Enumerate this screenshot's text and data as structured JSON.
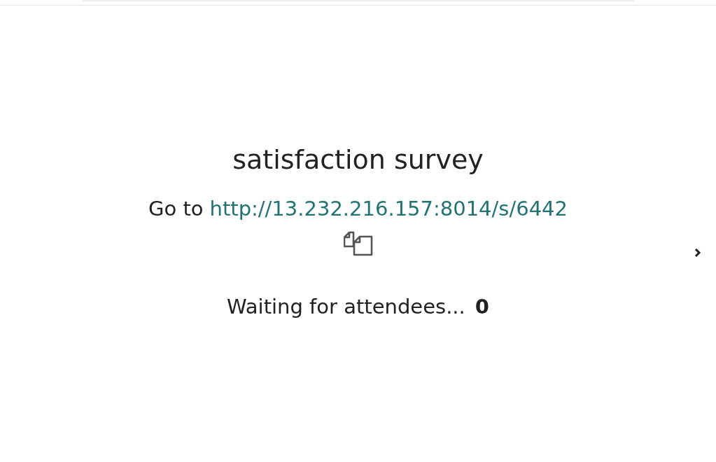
{
  "title": "satisfaction survey",
  "join": {
    "prefix": "Go to",
    "link": "http://13.232.216.157:8014/s/6442"
  },
  "waiting": {
    "label": "Waiting for attendees...",
    "count": "0"
  }
}
